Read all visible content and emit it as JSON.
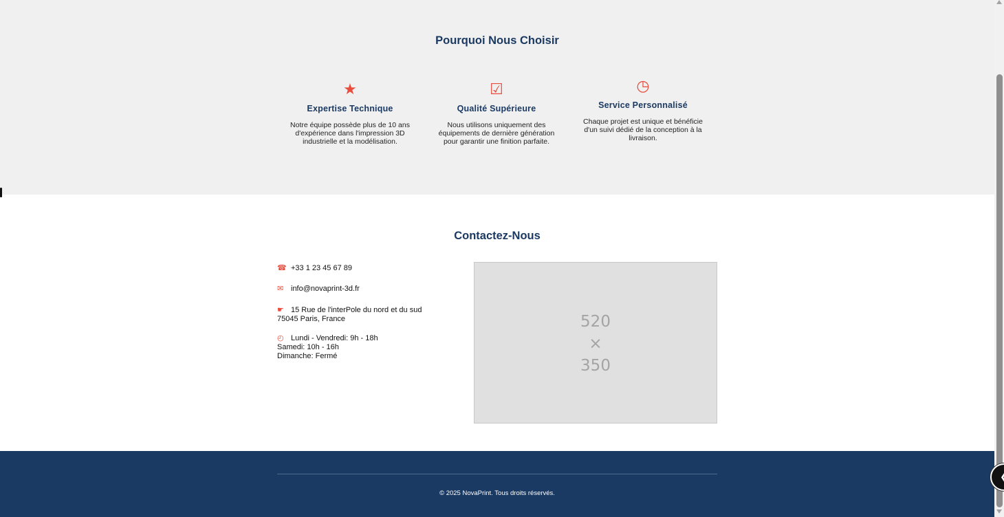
{
  "why": {
    "title": "Pourquoi Nous Choisir",
    "features": [
      {
        "icon": "star-icon",
        "glyph": "★",
        "title": "Expertise Technique",
        "text": "Notre équipe possède plus de 10 ans d'expérience dans l'impression 3D industrielle et la modélisation."
      },
      {
        "icon": "checkbox-icon",
        "glyph": "☑",
        "title": "Qualité Supérieure",
        "text": "Nous utilisons uniquement des équipements de dernière génération pour garantir une finition parfaite."
      },
      {
        "icon": "clock-icon",
        "glyph": "◷",
        "title": "Service Personnalisé",
        "text": "Chaque projet est unique et bénéficie d'un suivi dédié de la conception à la livraison."
      }
    ]
  },
  "contact": {
    "title": "Contactez-Nous",
    "phone_icon": "☎",
    "phone": "+33 1 23 45 67 89",
    "email_icon": "✉",
    "email": "info@novaprint-3d.fr",
    "address_icon": "☛",
    "address_line1": "15 Rue de l'interPole du nord et du sud",
    "address_line2": "75045 Paris, France",
    "hours_icon": "◴",
    "hours_line1": "Lundi - Vendredi: 9h - 18h",
    "hours_line2": "Samedi: 10h - 16h",
    "hours_line3": "Dimanche: Fermé",
    "map_placeholder": {
      "width_label": "520",
      "times": "×",
      "height_label": "350"
    }
  },
  "footer": {
    "copyright": "© 2025 NovaPrint. Tous droits réservés."
  },
  "colors": {
    "accent": "#e74c3c",
    "navy": "#1b3a63",
    "section_bg": "#f0f0f0"
  }
}
